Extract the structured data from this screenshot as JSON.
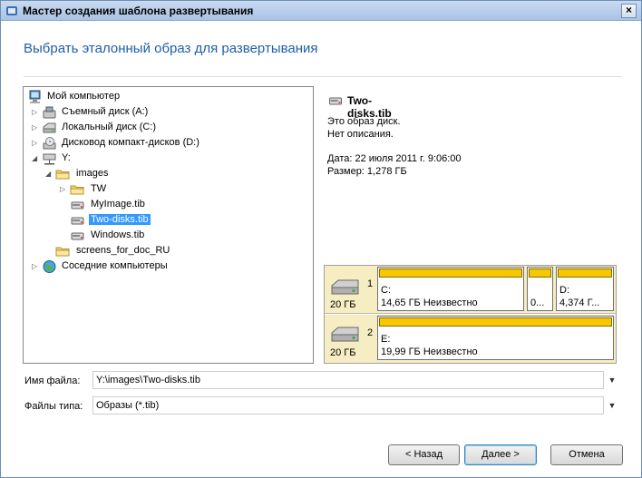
{
  "window": {
    "title": "Мастер создания шаблона развертывания",
    "close_glyph": "×"
  },
  "page": {
    "heading": "Выбрать эталонный образ для развертывания"
  },
  "tree": {
    "items": [
      {
        "label": "Мой компьютер",
        "icon": "computer-icon",
        "arrow": ""
      },
      {
        "label": "Съемный диск (A:)",
        "icon": "removable-disk-icon",
        "arrow": "▷"
      },
      {
        "label": "Локальный диск (C:)",
        "icon": "local-disk-icon",
        "arrow": "▷"
      },
      {
        "label": "Дисковод компакт-дисков (D:)",
        "icon": "cd-drive-icon",
        "arrow": "▷"
      },
      {
        "label": "Y:",
        "icon": "network-drive-icon",
        "arrow": "◢"
      },
      {
        "label": "images",
        "icon": "folder-icon",
        "arrow": "◢"
      },
      {
        "label": "TW",
        "icon": "folder-icon",
        "arrow": "▷"
      },
      {
        "label": "MyImage.tib",
        "icon": "tib-file-icon",
        "arrow": ""
      },
      {
        "label": "Two-disks.tib",
        "icon": "tib-file-icon",
        "arrow": "",
        "selected": true
      },
      {
        "label": "Windows.tib",
        "icon": "tib-file-icon",
        "arrow": ""
      },
      {
        "label": "screens_for_doc_RU",
        "icon": "folder-icon",
        "arrow": ""
      },
      {
        "label": "Соседние компьютеры",
        "icon": "network-globe-icon",
        "arrow": "▷"
      }
    ]
  },
  "info": {
    "filename": "Two-disks.tib",
    "line1": "Это образ диск.",
    "line2": "Нет описания.",
    "date": "Дата: 22 июля 2011 г. 9:06:00",
    "size": "Размер: 1,278 ГБ"
  },
  "disks": [
    {
      "number": "1",
      "size": "20 ГБ",
      "partitions": [
        {
          "letter": "C:",
          "text": "14,65 ГБ  Неизвестно"
        },
        {
          "letter": "",
          "text": "0..."
        },
        {
          "letter": "D:",
          "text": "4,374 Г..."
        }
      ]
    },
    {
      "number": "2",
      "size": "20 ГБ",
      "partitions": [
        {
          "letter": "E:",
          "text": "19,99 ГБ  Неизвестно"
        }
      ]
    }
  ],
  "fields": {
    "filename_label": "Имя файла:",
    "filename_value": "Y:\\images\\Two-disks.tib",
    "filetype_label": "Файлы типа:",
    "filetype_value": "Образы (*.tib)"
  },
  "buttons": {
    "back": "< Назад",
    "next": "Далее >",
    "cancel": "Отмена"
  }
}
